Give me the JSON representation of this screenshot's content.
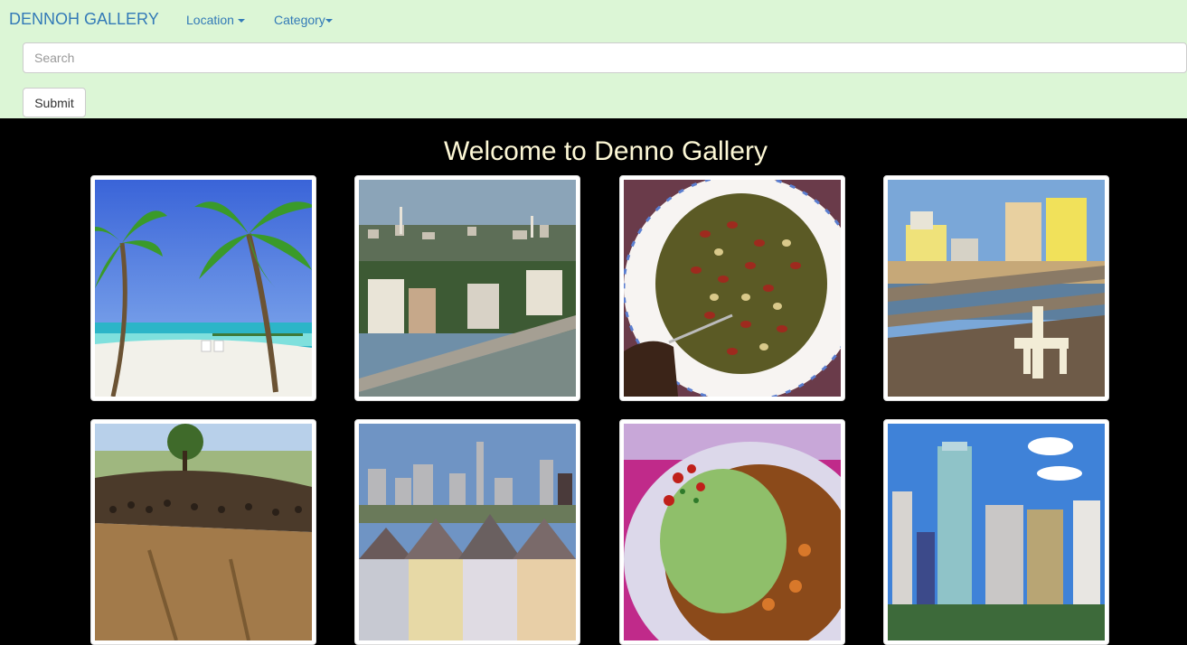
{
  "navbar": {
    "brand": "DENNOH GALLERY",
    "location_label": "Location",
    "category_label": "Category",
    "background": "#dcf6d6",
    "link_color": "#337ab7"
  },
  "search": {
    "placeholder": "Search",
    "value": "",
    "submit_label": "Submit"
  },
  "main": {
    "heading": "Welcome to Denno Gallery",
    "heading_color": "#fdf8d6",
    "background": "#000000"
  },
  "gallery": {
    "images": [
      {
        "subject": "tropical-beach-palms"
      },
      {
        "subject": "waterfront-city-houses"
      },
      {
        "subject": "plate-of-beans-and-greens"
      },
      {
        "subject": "beach-pier-and-hotels"
      },
      {
        "subject": "wildebeest-migration-cliff"
      },
      {
        "subject": "painted-ladies-houses-skyline"
      },
      {
        "subject": "plate-of-food-with-salad"
      },
      {
        "subject": "city-skyline-towers"
      }
    ]
  }
}
